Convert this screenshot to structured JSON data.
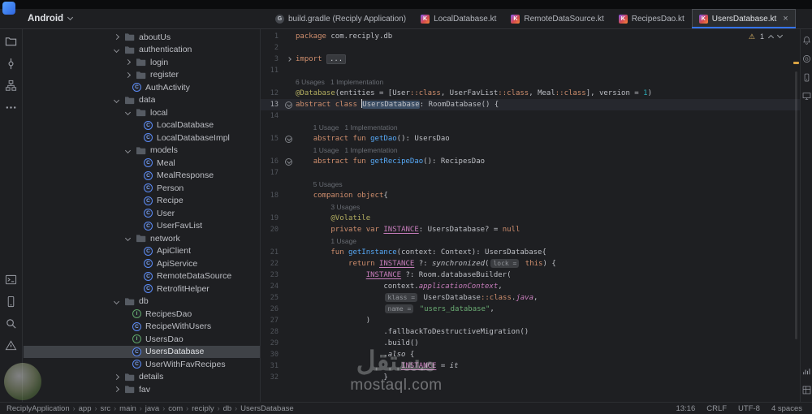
{
  "header": {
    "project_selector": "Android"
  },
  "glyphs": {
    "close": "×",
    "crumb_sep": "›",
    "warning": "⚠",
    "class_letter": "C",
    "interface_letter": "I",
    "tab_kotlin": "K",
    "tab_gradle": "G"
  },
  "tabs": {
    "items": [
      {
        "label": "build.gradle (Reciply Application)",
        "icon": "gradle",
        "active": false
      },
      {
        "label": "LocalDatabase.kt",
        "icon": "kotlin",
        "active": false
      },
      {
        "label": "RemoteDataSource.kt",
        "icon": "kotlin",
        "active": false
      },
      {
        "label": "RecipesDao.kt",
        "icon": "kotlin",
        "active": false
      },
      {
        "label": "UsersDatabase.kt",
        "icon": "kotlin",
        "active": true
      }
    ]
  },
  "left_strip": {
    "top": [
      "project",
      "commit",
      "structure",
      "more"
    ],
    "bottom": [
      "terminal",
      "devices",
      "search",
      "problems"
    ]
  },
  "right_strip": {
    "top": [
      "notifications",
      "gradle",
      "device-manager",
      "running-devices"
    ],
    "bottom": [
      "profiler",
      "layout-inspector"
    ]
  },
  "tree": {
    "items": [
      {
        "label": "aboutUs",
        "depth": 0,
        "chevron": "closed",
        "icon": "folder",
        "selected": false
      },
      {
        "label": "authentication",
        "depth": 0,
        "chevron": "open",
        "icon": "folder",
        "selected": false
      },
      {
        "label": "login",
        "depth": 1,
        "chevron": "closed",
        "icon": "folder",
        "selected": false
      },
      {
        "label": "register",
        "depth": 1,
        "chevron": "closed",
        "icon": "folder",
        "selected": false
      },
      {
        "label": "AuthActivity",
        "depth": 1,
        "chevron": null,
        "icon": "class",
        "selected": false
      },
      {
        "label": "data",
        "depth": 0,
        "chevron": "open",
        "icon": "folder",
        "selected": false
      },
      {
        "label": "local",
        "depth": 1,
        "chevron": "open",
        "icon": "folder",
        "selected": false
      },
      {
        "label": "LocalDatabase",
        "depth": 2,
        "chevron": null,
        "icon": "class",
        "selected": false
      },
      {
        "label": "LocalDatabaseImpl",
        "depth": 2,
        "chevron": null,
        "icon": "class",
        "selected": false
      },
      {
        "label": "models",
        "depth": 1,
        "chevron": "open",
        "icon": "folder",
        "selected": false
      },
      {
        "label": "Meal",
        "depth": 2,
        "chevron": null,
        "icon": "class",
        "selected": false
      },
      {
        "label": "MealResponse",
        "depth": 2,
        "chevron": null,
        "icon": "class",
        "selected": false
      },
      {
        "label": "Person",
        "depth": 2,
        "chevron": null,
        "icon": "class",
        "selected": false
      },
      {
        "label": "Recipe",
        "depth": 2,
        "chevron": null,
        "icon": "class",
        "selected": false
      },
      {
        "label": "User",
        "depth": 2,
        "chevron": null,
        "icon": "class",
        "selected": false
      },
      {
        "label": "UserFavList",
        "depth": 2,
        "chevron": null,
        "icon": "class",
        "selected": false
      },
      {
        "label": "network",
        "depth": 1,
        "chevron": "open",
        "icon": "folder",
        "selected": false
      },
      {
        "label": "ApiClient",
        "depth": 2,
        "chevron": null,
        "icon": "class",
        "selected": false
      },
      {
        "label": "ApiService",
        "depth": 2,
        "chevron": null,
        "icon": "class",
        "selected": false
      },
      {
        "label": "RemoteDataSource",
        "depth": 2,
        "chevron": null,
        "icon": "class",
        "selected": false
      },
      {
        "label": "RetrofitHelper",
        "depth": 2,
        "chevron": null,
        "icon": "class",
        "selected": false
      },
      {
        "label": "db",
        "depth": 0,
        "chevron": "open",
        "icon": "folder",
        "selected": false
      },
      {
        "label": "RecipesDao",
        "depth": 1,
        "chevron": null,
        "icon": "interface",
        "selected": false
      },
      {
        "label": "RecipeWithUsers",
        "depth": 1,
        "chevron": null,
        "icon": "class",
        "selected": false
      },
      {
        "label": "UsersDao",
        "depth": 1,
        "chevron": null,
        "icon": "interface",
        "selected": false
      },
      {
        "label": "UsersDatabase",
        "depth": 1,
        "chevron": null,
        "icon": "class",
        "selected": true
      },
      {
        "label": "UserWithFavRecipes",
        "depth": 1,
        "chevron": null,
        "icon": "class",
        "selected": false
      },
      {
        "label": "details",
        "depth": 0,
        "chevron": "closed",
        "icon": "folder",
        "selected": false
      },
      {
        "label": "fav",
        "depth": 0,
        "chevron": "closed",
        "icon": "folder",
        "selected": false
      }
    ]
  },
  "editor": {
    "inspection": {
      "warnings": "1"
    },
    "rows": [
      {
        "n": "1",
        "segs": [
          [
            "kw",
            "package "
          ],
          [
            "d",
            "com.reciply.db"
          ]
        ]
      },
      {
        "n": "2",
        "segs": []
      },
      {
        "n": "3",
        "mark": "fold",
        "segs": [
          [
            "kw",
            "import "
          ],
          [
            "fold",
            "..."
          ]
        ]
      },
      {
        "n": "11",
        "segs": []
      },
      {
        "hint": "6 Usages   1 Implementation"
      },
      {
        "n": "12",
        "segs": [
          [
            "ann",
            "@Database"
          ],
          [
            "d",
            "(entities = [User"
          ],
          [
            "kw",
            "::class"
          ],
          [
            "d",
            ", UserFavList"
          ],
          [
            "kw",
            "::class"
          ],
          [
            "d",
            ", Meal"
          ],
          [
            "kw",
            "::class"
          ],
          [
            "d",
            "], version = "
          ],
          [
            "num",
            "1"
          ],
          [
            "d",
            ")"
          ]
        ]
      },
      {
        "n": "13",
        "cur": true,
        "mark": "impl",
        "segs": [
          [
            "kw",
            "abstract class"
          ],
          [
            "d",
            " "
          ],
          [
            "caret",
            ""
          ],
          [
            "hl",
            "UsersDatabase"
          ],
          [
            "d",
            ": RoomDatabase() {"
          ]
        ]
      },
      {
        "n": "14",
        "segs": []
      },
      {
        "hint": "    1 Usage   1 Implementation"
      },
      {
        "n": "15",
        "mark": "impl",
        "segs": [
          [
            "d",
            "    "
          ],
          [
            "kw",
            "abstract fun"
          ],
          [
            "d",
            " "
          ],
          [
            "fn",
            "getDao"
          ],
          [
            "d",
            "(): UsersDao"
          ]
        ]
      },
      {
        "hint": "    1 Usage   1 Implementation"
      },
      {
        "n": "16",
        "mark": "impl",
        "segs": [
          [
            "d",
            "    "
          ],
          [
            "kw",
            "abstract fun"
          ],
          [
            "d",
            " "
          ],
          [
            "fn",
            "getRecipeDao"
          ],
          [
            "d",
            "(): RecipesDao"
          ]
        ]
      },
      {
        "n": "17",
        "segs": []
      },
      {
        "hint": "    5 Usages"
      },
      {
        "n": "18",
        "segs": [
          [
            "d",
            "    "
          ],
          [
            "kw",
            "companion object"
          ],
          [
            "d",
            "{"
          ]
        ]
      },
      {
        "hint": "        3 Usages"
      },
      {
        "n": "19",
        "segs": [
          [
            "d",
            "        "
          ],
          [
            "ann",
            "@Volatile"
          ]
        ]
      },
      {
        "n": "20",
        "segs": [
          [
            "d",
            "        "
          ],
          [
            "kw",
            "private var"
          ],
          [
            "d",
            " "
          ],
          [
            "field",
            "INSTANCE"
          ],
          [
            "d",
            ": UsersDatabase? = "
          ],
          [
            "kw",
            "null"
          ]
        ]
      },
      {
        "hint": "        1 Usage"
      },
      {
        "n": "21",
        "segs": [
          [
            "d",
            "        "
          ],
          [
            "kw",
            "fun"
          ],
          [
            "d",
            " "
          ],
          [
            "fn",
            "getInstance"
          ],
          [
            "d",
            "(context: Context): UsersDatabase{"
          ]
        ]
      },
      {
        "n": "22",
        "segs": [
          [
            "d",
            "            "
          ],
          [
            "kw",
            "return"
          ],
          [
            "d",
            " "
          ],
          [
            "field",
            "INSTANCE"
          ],
          [
            "d",
            " ?: "
          ],
          [
            "it",
            "synchronized"
          ],
          [
            "d",
            "("
          ],
          [
            "pill",
            "lock ="
          ],
          [
            "d",
            " "
          ],
          [
            "kw",
            "this"
          ],
          [
            "d",
            ") {"
          ]
        ]
      },
      {
        "n": "23",
        "segs": [
          [
            "d",
            "                "
          ],
          [
            "field",
            "INSTANCE"
          ],
          [
            "d",
            " ?: Room.databaseBuilder("
          ]
        ]
      },
      {
        "n": "24",
        "segs": [
          [
            "d",
            "                    context."
          ],
          [
            "prop",
            "applicationContext"
          ],
          [
            "d",
            ","
          ]
        ]
      },
      {
        "n": "25",
        "segs": [
          [
            "d",
            "                    "
          ],
          [
            "pill",
            "klass ="
          ],
          [
            "d",
            " UsersDatabase"
          ],
          [
            "kw",
            "::class"
          ],
          [
            "d",
            "."
          ],
          [
            "prop",
            "java"
          ],
          [
            "d",
            ","
          ]
        ]
      },
      {
        "n": "26",
        "segs": [
          [
            "d",
            "                    "
          ],
          [
            "pill",
            "name ="
          ],
          [
            "d",
            " "
          ],
          [
            "str",
            "\"users_database\""
          ],
          [
            "d",
            ","
          ]
        ]
      },
      {
        "n": "27",
        "segs": [
          [
            "d",
            "                )"
          ]
        ]
      },
      {
        "n": "28",
        "segs": [
          [
            "d",
            "                    .fallbackToDestructiveMigration()"
          ]
        ]
      },
      {
        "n": "29",
        "segs": [
          [
            "d",
            "                    .build()"
          ]
        ]
      },
      {
        "n": "30",
        "segs": [
          [
            "d",
            "                    ."
          ],
          [
            "it",
            "also"
          ],
          [
            "d",
            " {"
          ]
        ]
      },
      {
        "n": "31",
        "segs": [
          [
            "d",
            "                        "
          ],
          [
            "field",
            "INSTANCE"
          ],
          [
            "d",
            " = "
          ],
          [
            "it",
            "it"
          ]
        ]
      },
      {
        "n": "32",
        "segs": [
          [
            "d",
            "                    }"
          ]
        ]
      }
    ]
  },
  "status_bar": {
    "breadcrumbs": [
      "ReciplyApplication",
      "app",
      "src",
      "main",
      "java",
      "com",
      "reciply",
      "db",
      "UsersDatabase"
    ],
    "right": [
      "13:16",
      "CRLF",
      "UTF-8",
      "4 spaces"
    ]
  },
  "watermark": {
    "arabic": "مستقل",
    "latin": "mostaql.com"
  },
  "colors": {
    "accent": "#3574f0",
    "warning": "#e8bf6a",
    "selection": "#3f4247",
    "current_line": "#26282e"
  }
}
